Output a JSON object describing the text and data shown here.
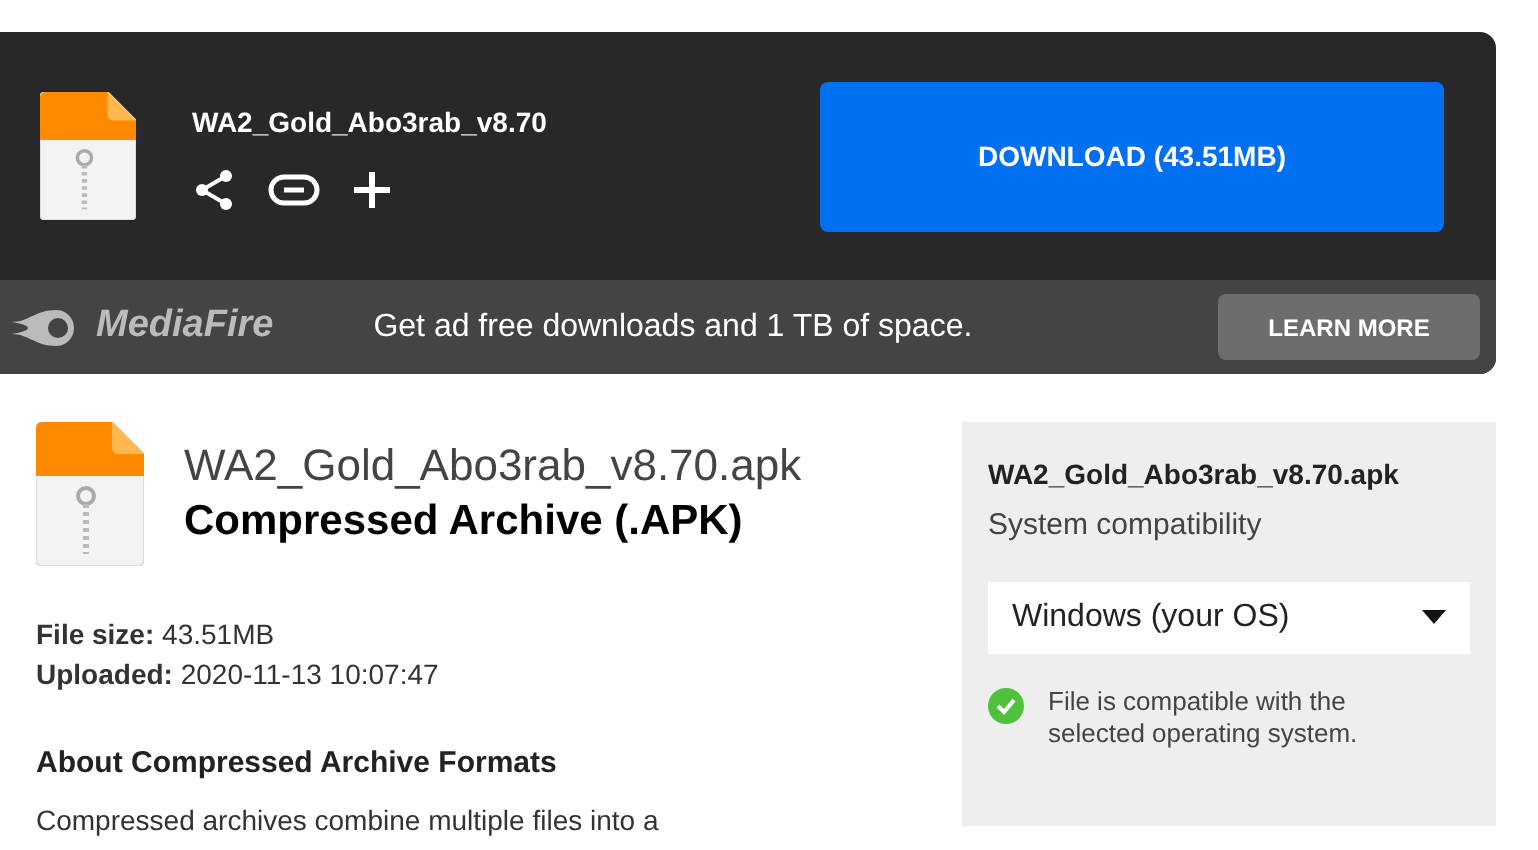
{
  "header": {
    "file_name": "WA2_Gold_Abo3rab_v8.70",
    "download_button": "DOWNLOAD (43.51MB)"
  },
  "promo_bar": {
    "logo": "MediaFire",
    "message": "Get ad free downloads and 1 TB of space.",
    "button": "LEARN MORE"
  },
  "file_info": {
    "file_name": "WA2_Gold_Abo3rab_v8.70.apk",
    "file_type": "Compressed Archive (.APK)",
    "details": [
      {
        "label": "File size:",
        "value": "43.51MB"
      },
      {
        "label": "Uploaded:",
        "value": "2020-11-13 10:07:47"
      }
    ],
    "section_heading": "About Compressed Archive Formats",
    "section_text": "Compressed archives combine multiple files into a"
  },
  "compatibility_panel": {
    "file_name": "WA2_Gold_Abo3rab_v8.70.apk",
    "subtitle": "System compatibility",
    "os_select": "Windows (your OS)",
    "compatible": true,
    "message": "File is compatible with the selected operating system."
  }
}
